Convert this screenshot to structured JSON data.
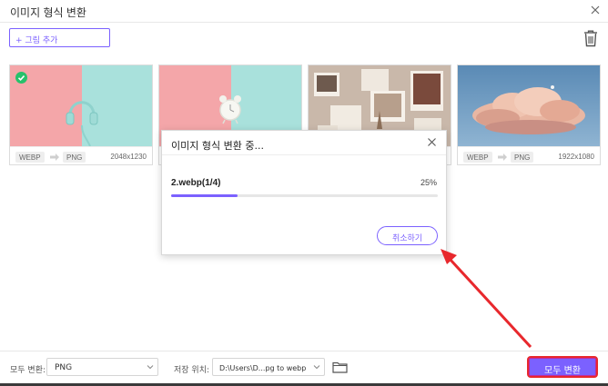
{
  "window": {
    "title": "이미지 형식 변환"
  },
  "toolbar": {
    "add_image_label": "+ 그림 추가"
  },
  "cards": [
    {
      "source_format": "WEBP",
      "target_format": "PNG",
      "dimensions": "2048x1230",
      "checked": true
    },
    {
      "source_format": "",
      "target_format": "",
      "dimensions": "",
      "checked": false
    },
    {
      "source_format": "",
      "target_format": "",
      "dimensions": "",
      "checked": false
    },
    {
      "source_format": "WEBP",
      "target_format": "PNG",
      "dimensions": "1922x1080",
      "checked": false
    }
  ],
  "dialog": {
    "title": "이미지 형식 변환 중...",
    "file_label": "2.webp(1/4)",
    "progress_text": "25%",
    "progress_fraction": 0.25,
    "cancel_label": "취소하기"
  },
  "bottom": {
    "convert_all_label": "모두 변환:",
    "convert_all_value": "PNG",
    "save_location_label": "저장 위치:",
    "save_location_value": "D:\\Users\\D...pg to webp",
    "convert_all_button": "모두 변환"
  },
  "colors": {
    "accent": "#7b61ff",
    "check": "#27c16b",
    "annotation": "#e8282d"
  }
}
